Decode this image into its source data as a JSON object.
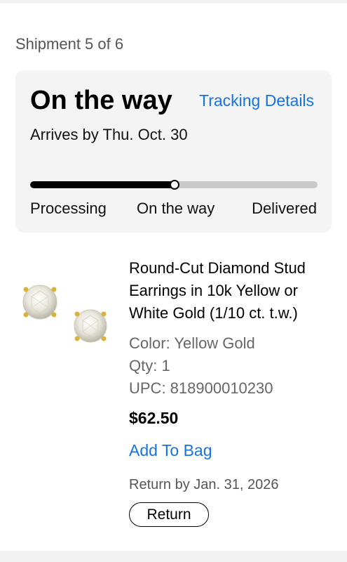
{
  "shipment": {
    "label": "Shipment 5 of 6",
    "status_title": "On the way",
    "tracking_link": "Tracking Details",
    "arrives": "Arrives by Thu. Oct. 30",
    "progress_fraction": 0.5,
    "steps": [
      "Processing",
      "On the way",
      "Delivered"
    ]
  },
  "product": {
    "image_icon": "diamond-stud-earrings-image",
    "name": "Round-Cut Diamond Stud Earrings in 10k Yellow or White Gold (1/10 ct. t.w.)",
    "color": "Color: Yellow Gold",
    "qty": "Qty: 1",
    "upc": "UPC: 818900010230",
    "price": "$62.50",
    "add_to_bag": "Add To Bag",
    "return_by": "Return by Jan. 31, 2026",
    "return_button": "Return"
  },
  "colors": {
    "link": "#1473e6",
    "card_bg": "#f4f4f4",
    "progress_fill": "#000000",
    "progress_track": "#c9c9c9"
  }
}
